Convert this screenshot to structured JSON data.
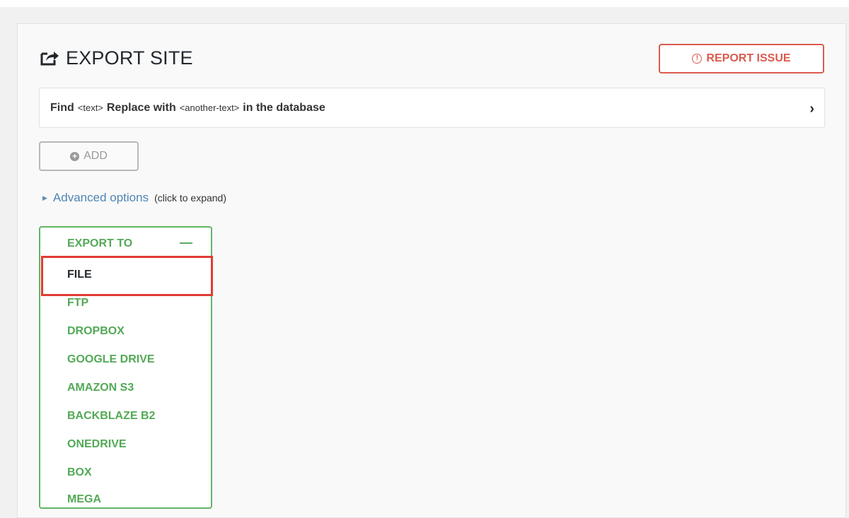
{
  "page": {
    "title": "EXPORT SITE",
    "title_icon": "export-share-icon"
  },
  "report": {
    "label": "REPORT ISSUE",
    "icon": "alert-circle-icon",
    "color": "#dc5a4f"
  },
  "find_replace": {
    "find_label": "Find",
    "find_placeholder": "<text>",
    "replace_label": "Replace with",
    "replace_placeholder": "<another-text>",
    "suffix": "in the database",
    "chevron_icon": "chevron-right-icon"
  },
  "add": {
    "label": "ADD",
    "icon": "plus-circle-icon"
  },
  "advanced": {
    "label": "Advanced options",
    "hint": "(click to expand)",
    "icon": "triangle-right-icon"
  },
  "export_to": {
    "header": "EXPORT TO",
    "collapse_symbol": "—",
    "accent_color": "#53a957",
    "selected": "FILE",
    "options": [
      "FILE",
      "FTP",
      "DROPBOX",
      "GOOGLE DRIVE",
      "AMAZON S3",
      "BACKBLAZE B2",
      "ONEDRIVE",
      "BOX",
      "MEGA"
    ]
  },
  "annotation": {
    "highlight_color": "#e23b33"
  }
}
